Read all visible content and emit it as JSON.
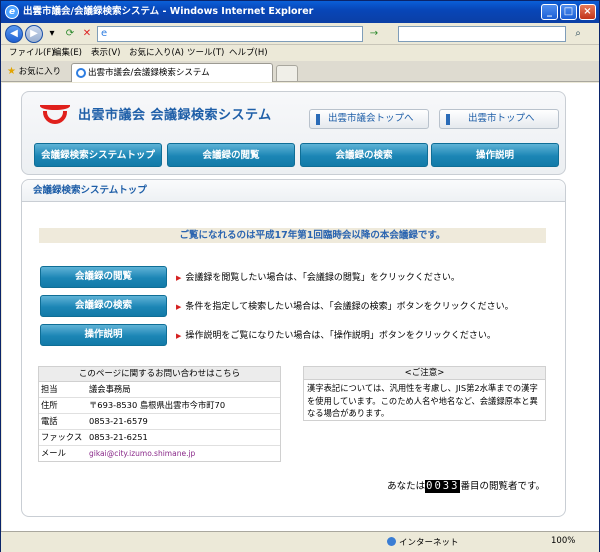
{
  "window": {
    "title": "出雲市議会/会議録検索システム - Windows Internet Explorer",
    "url": "",
    "search_placeholder": ""
  },
  "menu": [
    "ファイル(F)",
    "編集(E)",
    "表示(V)",
    "お気に入り(A)",
    "ツール(T)",
    "ヘルプ(H)"
  ],
  "tabs": {
    "favorites_label": "お気に入り",
    "active_tab": "出雲市議会/会議録検索システム"
  },
  "header": {
    "site_title": "出雲市議会 会議録検索システム",
    "link_council_top": "出雲市議会トップへ",
    "link_city_top": "出雲市トップへ",
    "nav": [
      "会議録検索システムトップ",
      "会議録の閲覧",
      "会議録の検索",
      "操作説明"
    ]
  },
  "main": {
    "section_title": "会議録検索システムトップ",
    "notice": "ご覧になれるのは平成17年第1回臨時会以降の本会議録です。",
    "actions": [
      {
        "label": "会議録の閲覧",
        "desc": "会議録を閲覧したい場合は、「会議録の閲覧」をクリックください。"
      },
      {
        "label": "会議録の検索",
        "desc": "条件を指定して検索したい場合は、「会議録の検索」ボタンをクリックください。"
      },
      {
        "label": "操作説明",
        "desc": "操作説明をご覧になりたい場合は、「操作説明」ボタンをクリックください。"
      }
    ],
    "contact": {
      "heading": "このページに関するお問い合わせはこちら",
      "rows": [
        {
          "key": "担当",
          "value": "議会事務局"
        },
        {
          "key": "住所",
          "value": "〒693-8530 島根県出雲市今市町70"
        },
        {
          "key": "電話",
          "value": "0853-21-6579"
        },
        {
          "key": "ファックス",
          "value": "0853-21-6251"
        },
        {
          "key": "メール",
          "value": "gikai@city.izumo.shimane.jp"
        }
      ]
    },
    "caution": {
      "heading": "<ご注意>",
      "body": "漢字表記については、汎用性を考慮し、JIS第2水準までの漢字を使用しています。このため人名や地名など、会議録原本と異なる場合があります。"
    },
    "counter": {
      "prefix": "あなたは",
      "number": "0033",
      "suffix": "番目の閲覧者です。"
    }
  },
  "status": {
    "zone": "インターネット",
    "zoom": "100%"
  }
}
